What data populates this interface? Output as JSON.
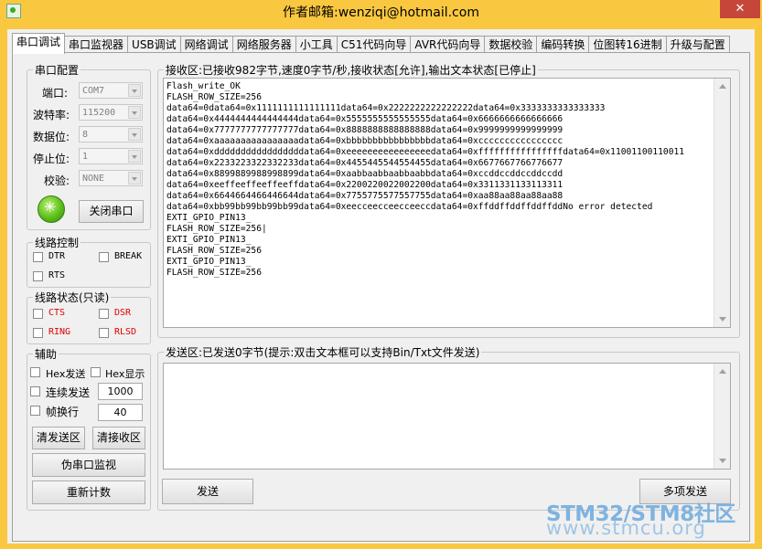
{
  "window": {
    "title": "作者邮箱:wenziqi@hotmail.com",
    "close_glyph": "✕"
  },
  "tabs": [
    {
      "label": "串口调试",
      "active": true
    },
    {
      "label": "串口监视器"
    },
    {
      "label": "USB调试"
    },
    {
      "label": "网络调试"
    },
    {
      "label": "网络服务器"
    },
    {
      "label": "小工具"
    },
    {
      "label": "C51代码向导"
    },
    {
      "label": "AVR代码向导"
    },
    {
      "label": "数据校验"
    },
    {
      "label": "编码转换"
    },
    {
      "label": "位图转16进制"
    },
    {
      "label": "升级与配置"
    }
  ],
  "serial_config": {
    "group_label": "串口配置",
    "port_label": "端口:",
    "port_value": "COM7",
    "baud_label": "波特率:",
    "baud_value": "115200",
    "databits_label": "数据位:",
    "databits_value": "8",
    "stopbits_label": "停止位:",
    "stopbits_value": "1",
    "parity_label": "校验:",
    "parity_value": "NONE",
    "close_button": "关闭串口"
  },
  "line_control": {
    "group_label": "线路控制",
    "dtr": "DTR",
    "break": "BREAK",
    "rts": "RTS"
  },
  "line_status": {
    "group_label": "线路状态(只读)",
    "cts": "CTS",
    "dsr": "DSR",
    "ring": "RING",
    "rlsd": "RLSD",
    "status_color": "#e00000"
  },
  "aux": {
    "group_label": "辅助",
    "hex_send": "Hex发送",
    "hex_display": "Hex显示",
    "continuous_send": "连续发送",
    "continuous_interval": "1000",
    "frame_newline": "帧换行",
    "frame_value": "40",
    "clear_send": "清发送区",
    "clear_recv": "清接收区",
    "virtual_monitor": "伪串口监视",
    "recount": "重新计数"
  },
  "receive": {
    "group_label": "接收区:已接收982字节,速度0字节/秒,接收状态[允许],输出文本状态[已停止]",
    "lines": [
      "Flash_write_OK",
      "FLASH_ROW_SIZE=256",
      "data64=0data64=0x1111111111111111data64=0x2222222222222222data64=0x3333333333333333",
      "data64=0x4444444444444444data64=0x5555555555555555data64=0x6666666666666666",
      "data64=0x7777777777777777data64=0x8888888888888888data64=0x9999999999999999",
      "data64=0xaaaaaaaaaaaaaaaadata64=0xbbbbbbbbbbbbbbbbdata64=0xcccccccccccccccc",
      "data64=0xdddddddddddddddddata64=0xeeeeeeeeeeeeeeeedata64=0xffffffffffffffffdata64=0x11001100110011",
      "data64=0x2233223322332233data64=0x4455445544554455data64=0x6677667766776677",
      "data64=0x8899889988998899data64=0xaabbaabbaabbaabbdata64=0xccddccddccddccdd",
      "data64=0xeeffeeffeeffeeffdata64=0x2200220022002200data64=0x3311331133113311",
      "data64=0x6644664466446644data64=0x7755775577557755data64=0xaa88aa88aa88aa88",
      "data64=0xbb99bb99bb99bb99data64=0xeecceecceecceeccdata64=0xffddffddffddffddNo error detected",
      "EXTI_GPIO_PIN13_",
      "FLASH_ROW_SIZE=256|",
      "EXTI_GPIO_PIN13_",
      "FLASH_ROW_SIZE=256",
      "EXTI_GPIO_PIN13_",
      "FLASH_ROW_SIZE=256"
    ]
  },
  "send": {
    "group_label": "发送区:已发送0字节(提示:双击文本框可以支持Bin/Txt文件发送)",
    "send_button": "发送",
    "multi_send_button": "多项发送"
  },
  "watermark": {
    "line1": "STM32/STM8社区",
    "line2": "www.stmcu.org"
  },
  "colors": {
    "frame": "#fac840",
    "close": "#c7463a",
    "watermark": "#7fb3e0"
  }
}
